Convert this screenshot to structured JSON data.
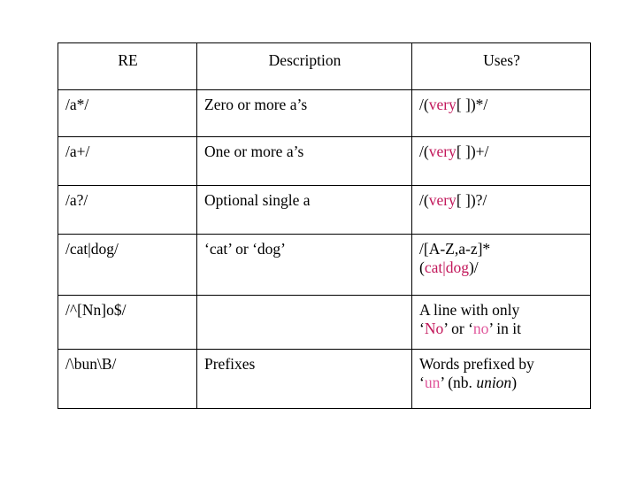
{
  "slide": {
    "background_color": "#ffffff",
    "text_color": "#000000",
    "highlight_color": "#c2185b",
    "highlight_soft_color": "#e0559a"
  },
  "table": {
    "headers": {
      "re": "RE",
      "description": "Description",
      "uses": "Uses?"
    },
    "rows": [
      {
        "re": "/a*/",
        "description": "Zero or more a’s",
        "uses_pre": "/(",
        "uses_hl": "very",
        "uses_post": "[ ])*/"
      },
      {
        "re": "/a+/",
        "description": "One or more a’s",
        "uses_pre": "/(",
        "uses_hl": "very",
        "uses_post": "[ ])+/"
      },
      {
        "re": "/a?/",
        "description": "Optional single a",
        "uses_pre": "/(",
        "uses_hl": "very",
        "uses_post": "[ ])?/"
      },
      {
        "re": "/cat|dog/",
        "description": "‘cat’ or ‘dog’",
        "uses_line1": "/[A-Z,a-z]*",
        "uses_line2_pre": "(",
        "uses_line2_hl": "cat|dog",
        "uses_line2_post": ")/"
      },
      {
        "re": "/^[Nn]o$/",
        "description": "",
        "uses_line1": "A line with only",
        "uses_line2_a": "‘",
        "uses_line2_hl1": "No",
        "uses_line2_b": "’ or ‘",
        "uses_line2_hl2": "no",
        "uses_line2_c": "’ in it"
      },
      {
        "re": "/\\bun\\B/",
        "description": "Prefixes",
        "uses_line1": "Words prefixed by",
        "uses_line2_a": "‘",
        "uses_line2_hl1": "un",
        "uses_line2_b": "’ (nb. ",
        "uses_line2_ital": "union",
        "uses_line2_c": ")"
      }
    ]
  }
}
